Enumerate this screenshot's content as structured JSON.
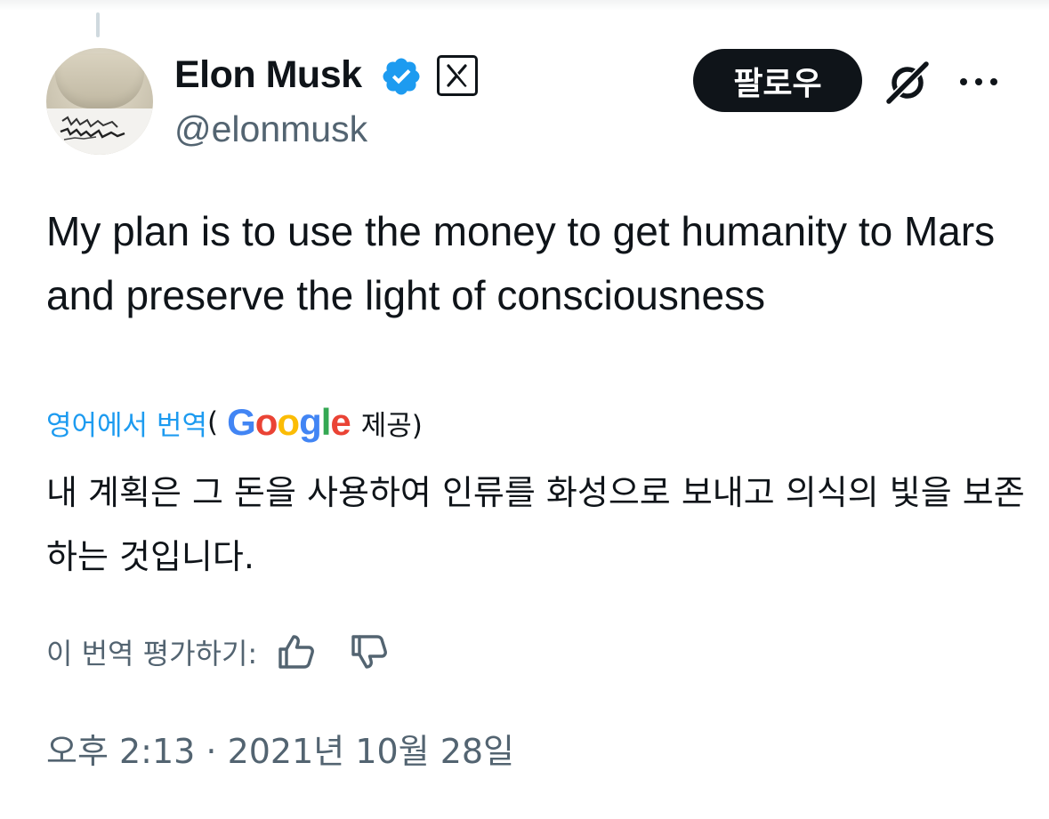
{
  "author": {
    "name": "Elon Musk",
    "handle": "@elonmusk",
    "verified_color": "#1d9bf0"
  },
  "actions": {
    "follow_label": "팔로우",
    "grok_icon": "grok-icon",
    "more_icon": "more-icon"
  },
  "tweet": {
    "text": "My plan is to use the money to get humanity to Mars and preserve the light of consciousness"
  },
  "translation": {
    "link_label": "영어에서 번역",
    "open_paren": "(",
    "provider": "Google",
    "provided_label": "제공)",
    "text": "내 계획은 그 돈을 사용하여 인류를 화성으로 보내고 의식의 빛을 보존하는 것입니다.",
    "rate_label": "이 번역 평가하기:",
    "thumbs_up_icon": "thumbs-up-icon",
    "thumbs_down_icon": "thumbs-down-icon"
  },
  "meta": {
    "timestamp": "오후 2:13 · 2021년 10월 28일"
  },
  "colors": {
    "text": "#0f1419",
    "secondary": "#536471",
    "link": "#1d9bf0",
    "google_blue": "#4285f4",
    "google_red": "#ea4335",
    "google_yellow": "#fbbc05",
    "google_green": "#34a853"
  }
}
